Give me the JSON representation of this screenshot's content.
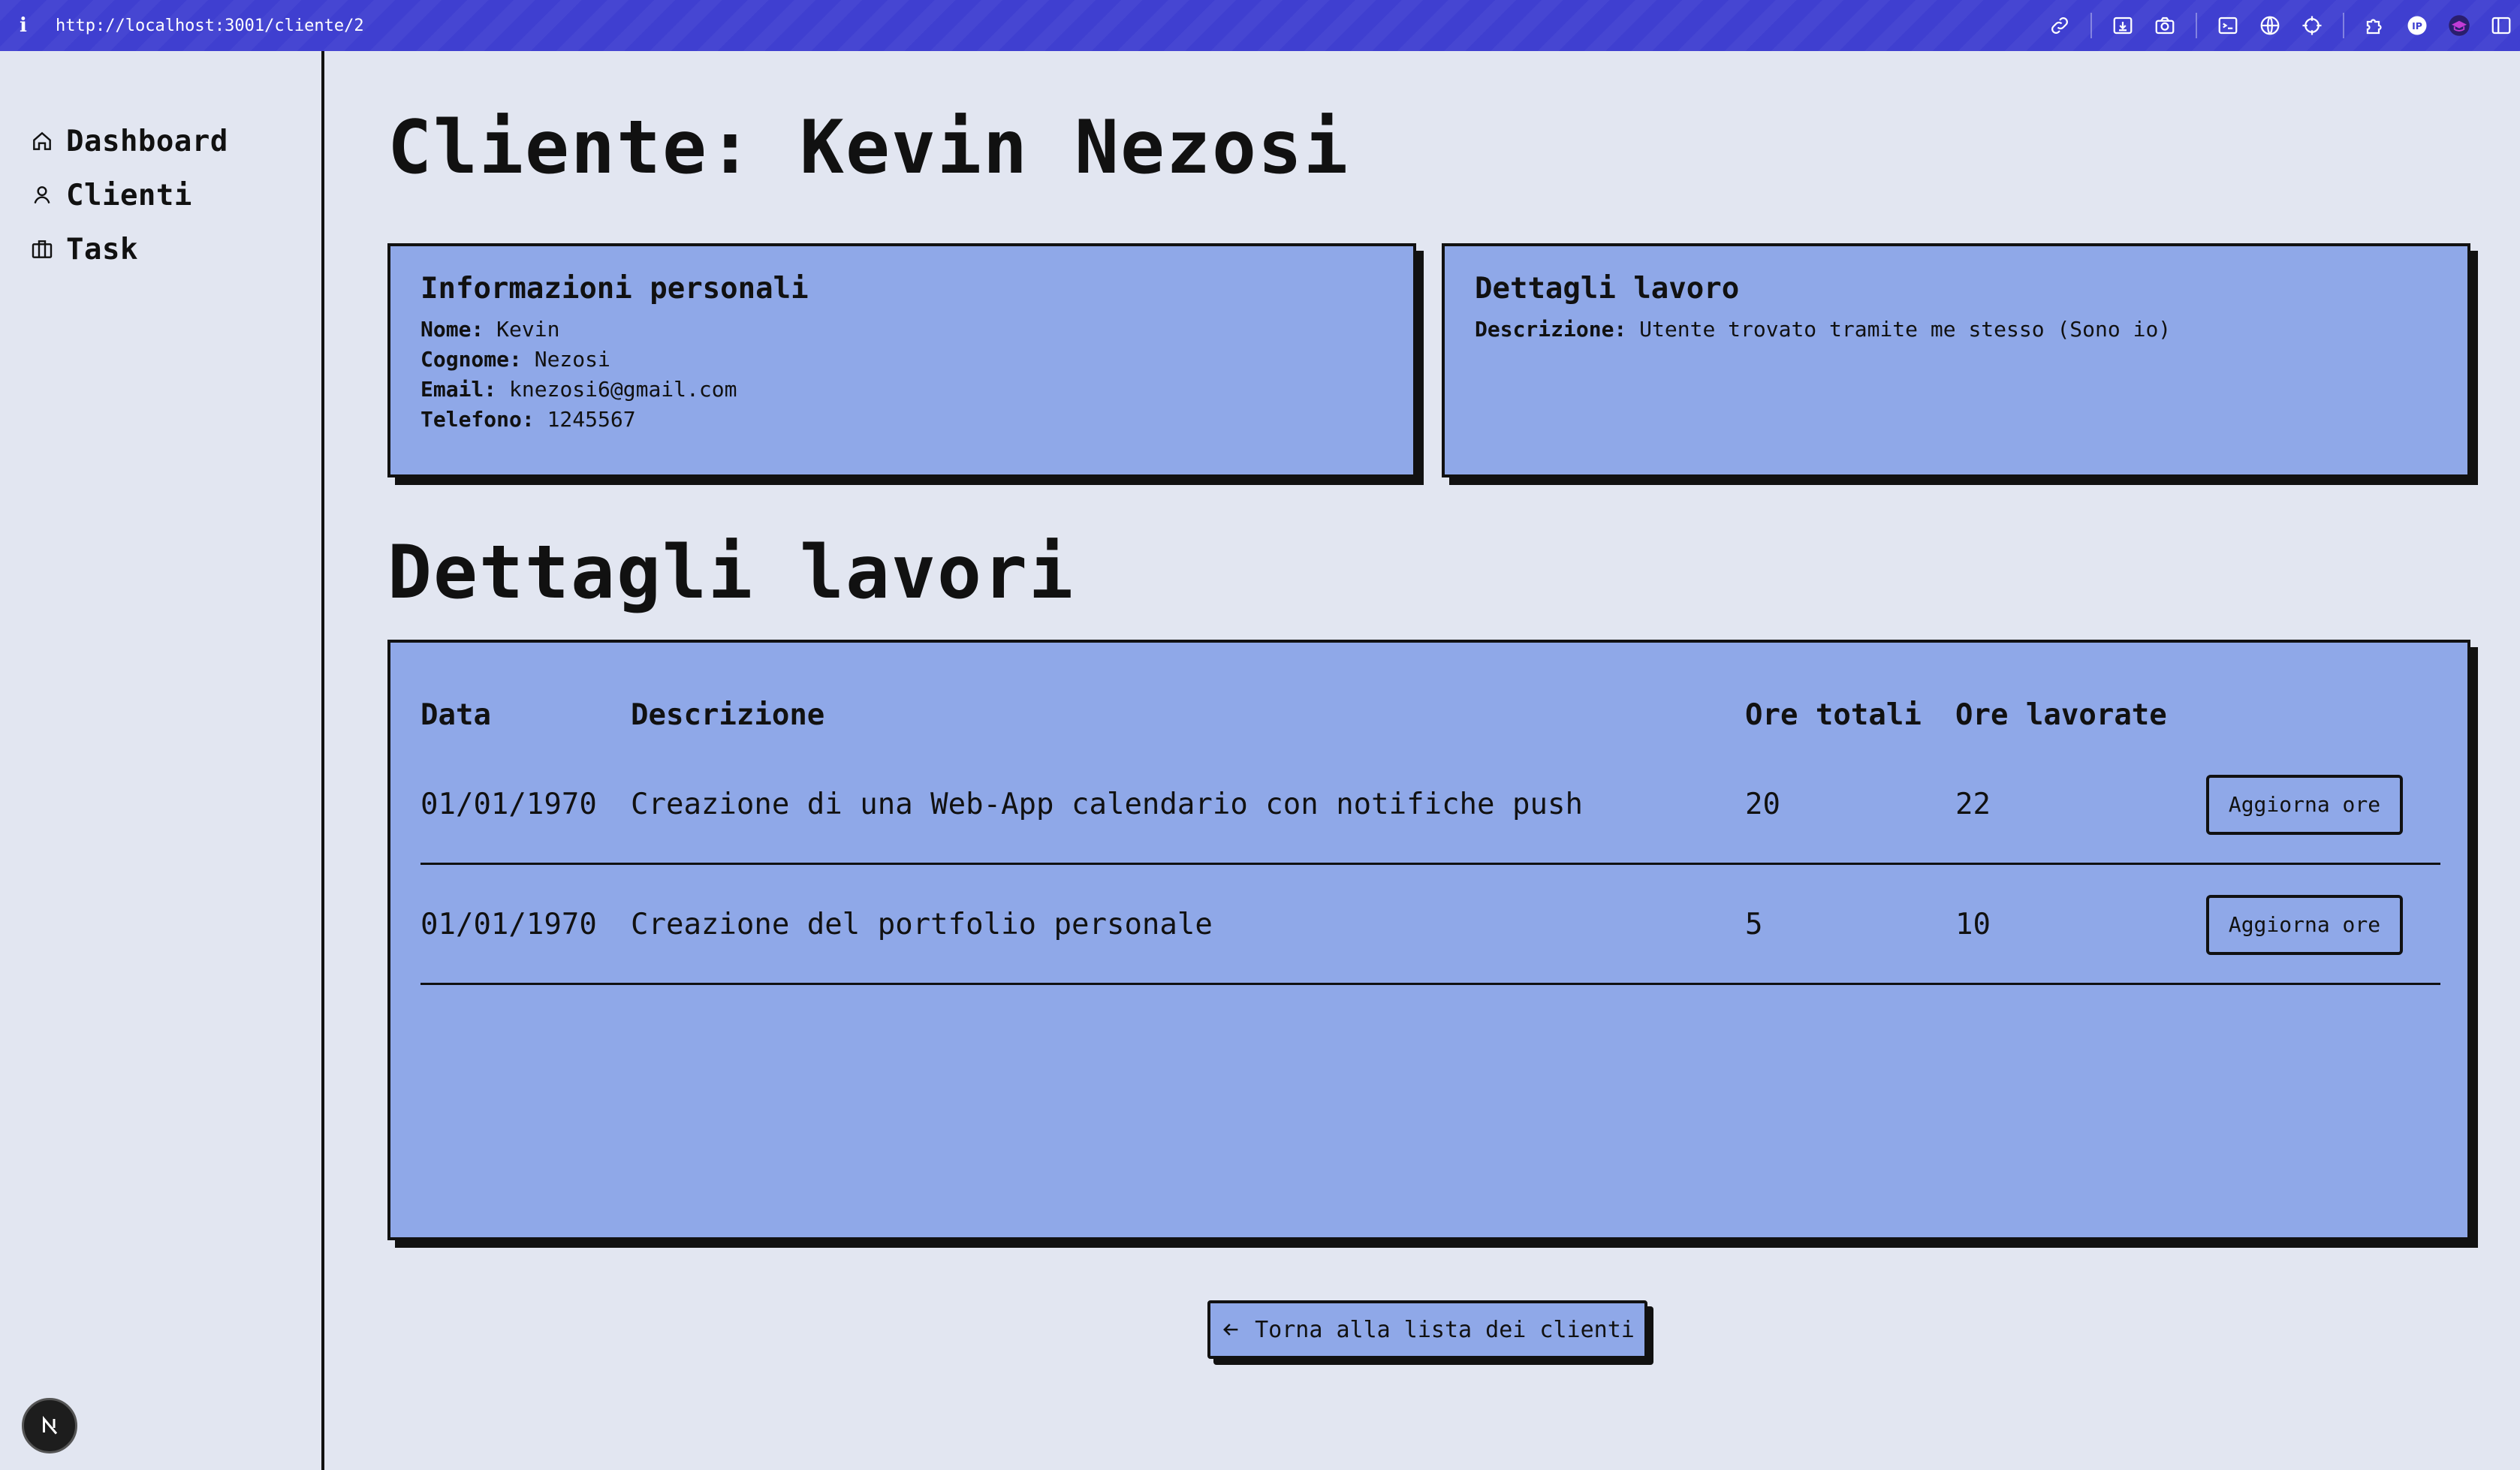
{
  "browser": {
    "info_icon": "i",
    "url": "http://localhost:3001/cliente/2",
    "toolbar_icons": [
      "link-icon",
      "download-icon",
      "camera-icon",
      "terminal-icon",
      "globe-icon",
      "crosshair-icon",
      "extension-icon",
      "profile-badge-icon",
      "graduation-cap-icon",
      "sidebar-toggle-icon"
    ]
  },
  "sidebar": {
    "items": [
      {
        "label": "Dashboard",
        "icon": "home-icon"
      },
      {
        "label": "Clienti",
        "icon": "user-icon"
      },
      {
        "label": "Task",
        "icon": "briefcase-icon"
      }
    ],
    "badge_icon": "nextjs-icon"
  },
  "page": {
    "title": "Cliente: Kevin Nezosi"
  },
  "personal": {
    "heading": "Informazioni personali",
    "nome_label": "Nome:",
    "nome": "Kevin",
    "cognome_label": "Cognome:",
    "cognome": "Nezosi",
    "email_label": "Email:",
    "email": "knezosi6@gmail.com",
    "telefono_label": "Telefono:",
    "telefono": "1245567"
  },
  "work": {
    "heading": "Dettagli lavoro",
    "descrizione_label": "Descrizione:",
    "descrizione": "Utente trovato tramite me stesso (Sono io)"
  },
  "jobs": {
    "title": "Dettagli lavori",
    "columns": [
      "Data",
      "Descrizione",
      "Ore totali",
      "Ore lavorate"
    ],
    "rows": [
      {
        "data": "01/01/1970",
        "descrizione": "Creazione di una Web-App calendario con notifiche push",
        "ore_totali": "20",
        "ore_lavorate": "22",
        "button": "Aggiorna ore"
      },
      {
        "data": "01/01/1970",
        "descrizione": "Creazione del portfolio personale",
        "ore_totali": "5",
        "ore_lavorate": "10",
        "button": "Aggiorna ore"
      }
    ]
  },
  "back_button": {
    "label": "Torna alla lista dei clienti",
    "icon": "arrow-left-icon"
  },
  "colors": {
    "topbar": "#3f3fd0",
    "background": "#e2e6f1",
    "card": "#8fa8e8",
    "border": "#111111"
  }
}
